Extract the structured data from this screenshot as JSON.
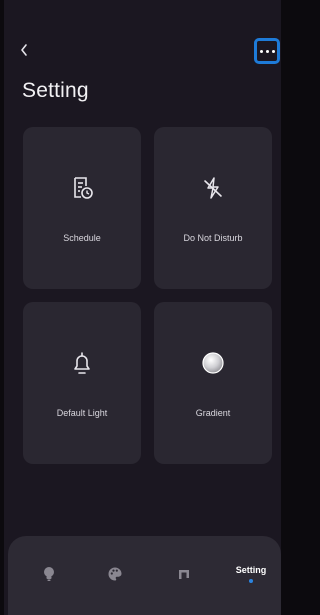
{
  "header": {
    "title": "Setting",
    "back_icon": "chevron-left-icon",
    "more_icon": "more-dots-icon",
    "accent_color": "#1e7bd8"
  },
  "cards": [
    {
      "id": "schedule",
      "label": "Schedule",
      "icon": "schedule-clock-icon"
    },
    {
      "id": "do-not-disturb",
      "label": "Do Not Disturb",
      "icon": "flash-off-icon"
    },
    {
      "id": "default-light",
      "label": "Default Light",
      "icon": "bell-icon"
    },
    {
      "id": "gradient",
      "label": "Gradient",
      "icon": "gradient-circle-icon"
    }
  ],
  "tabbar": {
    "tabs": [
      {
        "id": "light",
        "icon": "bulb-icon",
        "label": ""
      },
      {
        "id": "palette",
        "icon": "palette-icon",
        "label": ""
      },
      {
        "id": "music",
        "icon": "music-icon",
        "label": ""
      },
      {
        "id": "setting",
        "icon": "",
        "label": "Setting",
        "active": true
      }
    ],
    "active_indicator_color": "#2b84e0"
  },
  "colors": {
    "background": "#1b1721",
    "card": "#2a2731",
    "tabbar": "#2d2a34"
  }
}
